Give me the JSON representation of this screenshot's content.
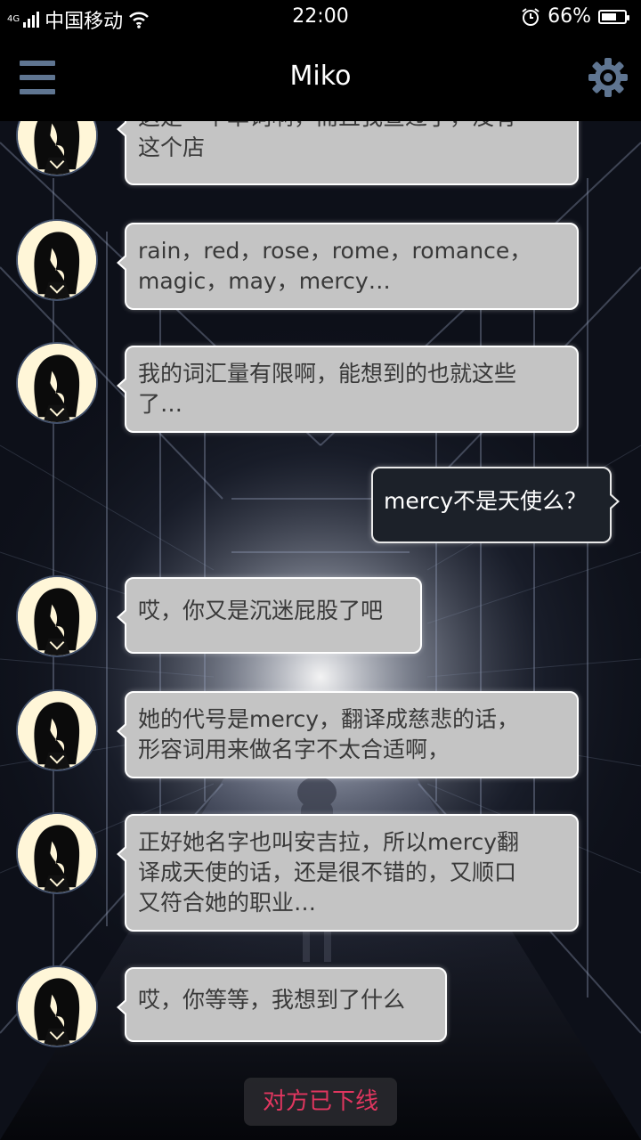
{
  "status_bar": {
    "network_type": "4G",
    "carrier": "中国移动",
    "time": "22:00",
    "battery_percent": "66%",
    "battery_level": 0.66,
    "icons": [
      "signal-icon",
      "wifi-icon",
      "alarm-icon",
      "battery-icon"
    ]
  },
  "header": {
    "title": "Miko",
    "menu_icon": "hamburger-menu-icon",
    "settings_icon": "gear-icon",
    "accent_color": "#5f7591"
  },
  "messages": [
    {
      "sender": "Miko",
      "direction": "incoming",
      "text": "这是一个单词啊，而且我查过了，没有这个店",
      "lines": [
        "这是一个单词啊，而且我查过了，没有",
        "这个店"
      ]
    },
    {
      "sender": "Miko",
      "direction": "incoming",
      "text": "rain，red，rose，rome，romance，magic，may，mercy…",
      "lines": [
        "rain，red，rose，rome，romance，",
        "magic，may，mercy…"
      ]
    },
    {
      "sender": "Miko",
      "direction": "incoming",
      "text": "我的词汇量有限啊，能想到的也就这些了…",
      "lines": [
        "我的词汇量有限啊，能想到的也就这些",
        "了…"
      ]
    },
    {
      "sender": "me",
      "direction": "outgoing",
      "text": "mercy不是天使么？",
      "lines": [
        "mercy不是天使么？"
      ]
    },
    {
      "sender": "Miko",
      "direction": "incoming",
      "text": "哎，你又是沉迷屁股了吧",
      "lines": [
        "哎，你又是沉迷屁股了吧"
      ]
    },
    {
      "sender": "Miko",
      "direction": "incoming",
      "text": "她的代号是mercy，翻译成慈悲的话，形容词用来做名字不太合适啊，",
      "lines": [
        "她的代号是mercy，翻译成慈悲的话，",
        "形容词用来做名字不太合适啊，"
      ]
    },
    {
      "sender": "Miko",
      "direction": "incoming",
      "text": "正好她名字也叫安吉拉，所以mercy翻译成天使的话，还是很不错的，又顺口又符合她的职业…",
      "lines": [
        "正好她名字也叫安吉拉，所以mercy翻",
        "译成天使的话，还是很不错的，又顺口",
        "又符合她的职业…"
      ]
    },
    {
      "sender": "Miko",
      "direction": "incoming",
      "text": "哎，你等等，我想到了什么",
      "lines": [
        "哎，你等等，我想到了什么"
      ]
    }
  ],
  "system_notice": {
    "text": "对方已下线",
    "color": "#e0365f"
  },
  "colors": {
    "incoming_bubble": "#c4c4c4",
    "outgoing_bubble": "#1c2129",
    "avatar_background": "#fff6d8"
  }
}
